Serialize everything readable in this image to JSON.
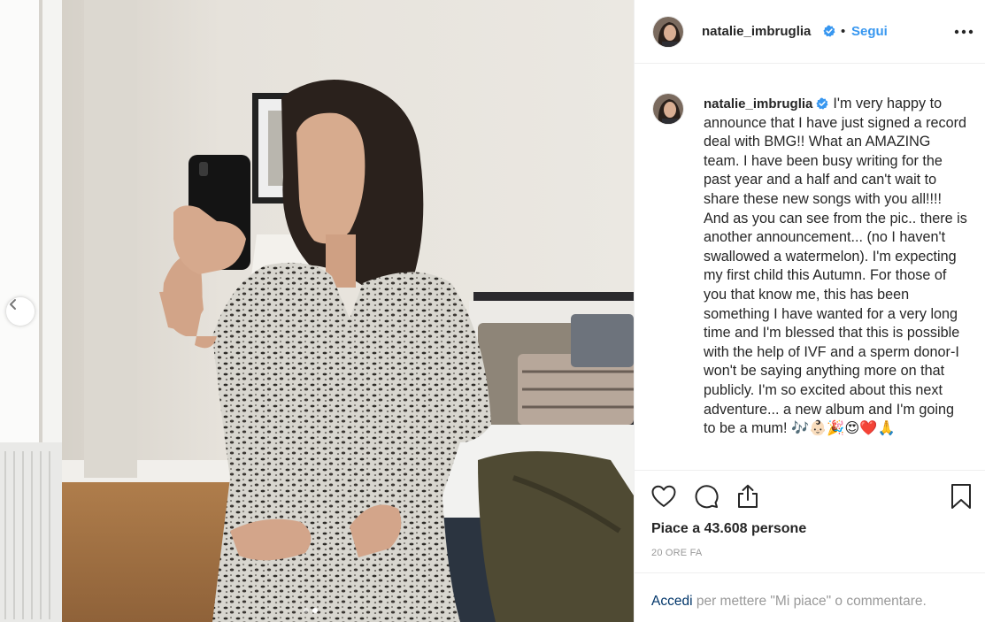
{
  "post": {
    "username": "natalie_imbruglia",
    "follow_separator": "•",
    "follow_label": "Segui",
    "caption": "I'm very happy to announce that I have just signed a record deal with BMG!! What an AMAZING team. I have been busy writing for the past year and a half and can't wait to share these new songs with you all!!!! And as you can see from the pic.. there is another announcement... (no I haven't swallowed a watermelon). I'm expecting my first child this Autumn. For those of you that know me, this has been something I have wanted for a very long time and I'm blessed that this is possible with the help of IVF and a sperm donor-I won't be saying anything more on that publicly. I'm so excited about this next adventure... a new album and I'm going to be a mum! 🎶👶🏻🎉😍❤️🙏",
    "likes": "Piace a 43.608 persone",
    "time": "20 ORE FA",
    "carousel": {
      "count": 2,
      "active": 2
    }
  },
  "login": {
    "link": "Accedi",
    "text": " per mettere \"Mi piace\" o commentare."
  },
  "colors": {
    "link_blue": "#3897f0",
    "verified_blue": "#3897f0",
    "text": "#262626",
    "muted": "#999999",
    "login_link": "#003569"
  },
  "icons": [
    "chevron-left-icon",
    "verified-badge-icon",
    "more-options-icon",
    "heart-icon",
    "comment-icon",
    "share-icon",
    "bookmark-icon"
  ]
}
